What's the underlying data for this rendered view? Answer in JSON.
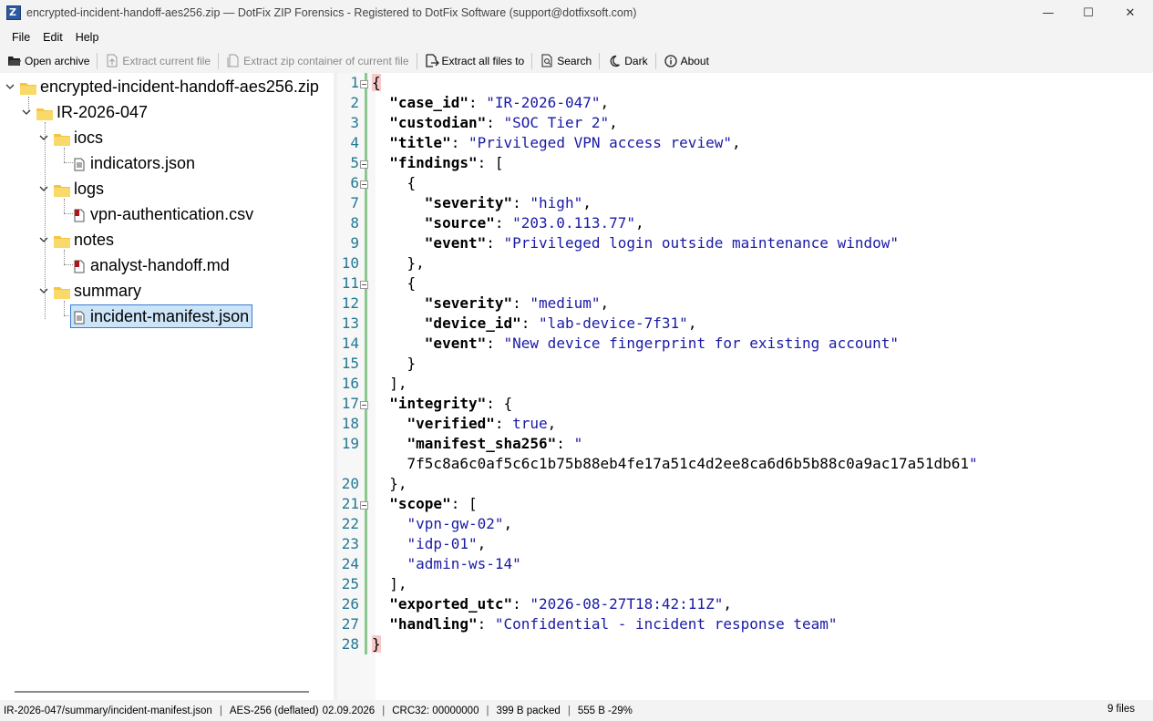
{
  "window": {
    "title": "encrypted-incident-handoff-aes256.zip — DotFix ZIP Forensics - Registered to DotFix Software (support@dotfixsoft.com)",
    "controls": {
      "minimize": "—",
      "maximize": "☐",
      "close": "✕"
    }
  },
  "menu": {
    "file": "File",
    "edit": "Edit",
    "help": "Help"
  },
  "toolbar": {
    "open_archive": "Open archive",
    "extract_current": "Extract current file",
    "extract_container": "Extract zip container of current file",
    "extract_all": "Extract all files to",
    "search": "Search",
    "dark": "Dark",
    "about": "About"
  },
  "tree": {
    "root": "encrypted-incident-handoff-aes256.zip",
    "case_folder": "IR-2026-047",
    "iocs": "iocs",
    "indicators": "indicators.json",
    "logs": "logs",
    "vpn": "vpn-authentication.csv",
    "notes": "notes",
    "handoff": "analyst-handoff.md",
    "summary": "summary",
    "manifest": "incident-manifest.json"
  },
  "editor": {
    "lines": [
      "{",
      "  \"case_id\": \"IR-2026-047\",",
      "  \"custodian\": \"SOC Tier 2\",",
      "  \"title\": \"Privileged VPN access review\",",
      "  \"findings\": [",
      "    {",
      "      \"severity\": \"high\",",
      "      \"source\": \"203.0.113.77\",",
      "      \"event\": \"Privileged login outside maintenance window\"",
      "    },",
      "    {",
      "      \"severity\": \"medium\",",
      "      \"device_id\": \"lab-device-7f31\",",
      "      \"event\": \"New device fingerprint for existing account\"",
      "    }",
      "  ],",
      "  \"integrity\": {",
      "    \"verified\": true,",
      "    \"manifest_sha256\": \"",
      "    7f5c8a6c0af5c6c1b75b88eb4fe17a51c4d2ee8ca6d6b5b88c0a9ac17a51db61\"",
      "  },",
      "  \"scope\": [",
      "    \"vpn-gw-02\",",
      "    \"idp-01\",",
      "    \"admin-ws-14\"",
      "  ],",
      "  \"exported_utc\": \"2026-08-27T18:42:11Z\",",
      "  \"handling\": \"Confidential - incident response team\"",
      "}"
    ],
    "line_numbers": [
      "1",
      "2",
      "3",
      "4",
      "5",
      "6",
      "7",
      "8",
      "9",
      "10",
      "11",
      "12",
      "13",
      "14",
      "15",
      "16",
      "17",
      "18",
      "19",
      "",
      "20",
      "21",
      "22",
      "23",
      "24",
      "25",
      "26",
      "27",
      "28"
    ]
  },
  "status": {
    "path": "IR-2026-047/summary/incident-manifest.json",
    "method": "AES-256 (deflated)",
    "date": "02.09.2026",
    "crc": "CRC32: 00000000",
    "packed": "399 B packed",
    "size": "555 B  -29%",
    "files": "9 files"
  },
  "colors": {
    "selection": "#cce4f7",
    "folder": "#f5c542",
    "keyword": "#000000",
    "string": "#1a1aa6",
    "line_number": "#237893"
  }
}
